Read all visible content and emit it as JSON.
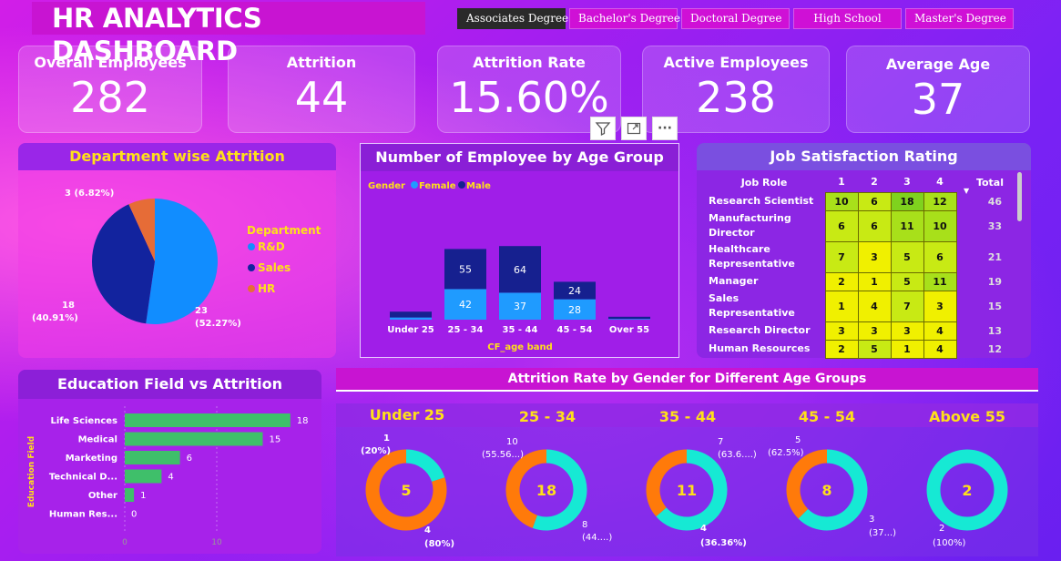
{
  "title": "HR ANALYTICS DASHBOARD",
  "slicers": [
    "Associates Degree",
    "Bachelor's Degree",
    "Doctoral Degree",
    "High School",
    "Master's Degree"
  ],
  "kpis": [
    {
      "label": "Overall Employees",
      "value": "282"
    },
    {
      "label": "Attrition",
      "value": "44"
    },
    {
      "label": "Attrition Rate",
      "value": "15.60%"
    },
    {
      "label": "Active Employees",
      "value": "238"
    },
    {
      "label": "Average Age",
      "value": "37"
    }
  ],
  "toolbar": {
    "filter_icon": "filter-icon",
    "focus_icon": "focus-mode-icon",
    "more": "···"
  },
  "dept": {
    "title": "Department wise Attrition",
    "legend_title": "Department",
    "legend": [
      "R&D",
      "Sales",
      "HR"
    ],
    "labels": {
      "hr": "3 (6.82%)",
      "sales_1": "18",
      "sales_2": "(40.91%)",
      "rd_1": "23",
      "rd_2": "(52.27%)"
    }
  },
  "age": {
    "title": "Number of Employee by Age Group",
    "legend_title": "Gender",
    "legend": [
      "Female",
      "Male"
    ],
    "xlabel": "CF_age band"
  },
  "job": {
    "title": "Job Satisfaction Rating",
    "headers": [
      "Job Role",
      "1",
      "2",
      "3",
      "4",
      "Total"
    ],
    "rows": [
      {
        "role": "Research Scientist",
        "v": [
          "10",
          "6",
          "18",
          "12"
        ],
        "total": "46"
      },
      {
        "role": "Manufacturing Director",
        "v": [
          "6",
          "6",
          "11",
          "10"
        ],
        "total": "33"
      },
      {
        "role": "Healthcare Representative",
        "v": [
          "7",
          "3",
          "5",
          "6"
        ],
        "total": "21"
      },
      {
        "role": "Manager",
        "v": [
          "2",
          "1",
          "5",
          "11"
        ],
        "total": "19"
      },
      {
        "role": "Sales Representative",
        "v": [
          "1",
          "4",
          "7",
          "3"
        ],
        "total": "15"
      },
      {
        "role": "Research Director",
        "v": [
          "3",
          "3",
          "3",
          "4"
        ],
        "total": "13"
      },
      {
        "role": "Human Resources",
        "v": [
          "2",
          "5",
          "1",
          "4"
        ],
        "total": "12"
      }
    ]
  },
  "edu": {
    "title": "Education Field vs Attrition",
    "ylabel": "Education Field"
  },
  "gender": {
    "title": "Attrition Rate by Gender for Different Age Groups"
  },
  "donuts": [
    {
      "title": "Under 25",
      "center": "5",
      "l1": "1",
      "l2": "(20%)",
      "l3": "4",
      "l4": "(80%)"
    },
    {
      "title": "25 - 34",
      "center": "18",
      "l1": "10",
      "l2": "(55.56...)",
      "l3": "8",
      "l4": "(44....)"
    },
    {
      "title": "35 - 44",
      "center": "11",
      "l1": "7",
      "l2": "(63.6....)",
      "l3": "4",
      "l4": "(36.36%)"
    },
    {
      "title": "45 - 54",
      "center": "8",
      "l1": "5",
      "l2": "(62.5%)",
      "l3": "3",
      "l4": "(37...)"
    },
    {
      "title": "Above 55",
      "center": "2",
      "l1": "2",
      "l2": "(100%)"
    }
  ],
  "colors": {
    "rd": "#118dff",
    "sales": "#12239e",
    "hr": "#e66c37",
    "female": "#1f9bff",
    "male": "#16208f",
    "bar": "#3fbf6a",
    "teal": "#16e9d4",
    "orange": "#ff7a0a",
    "yellow": "#ffe01a"
  },
  "chart_data": [
    {
      "type": "pie",
      "title": "Department wise Attrition",
      "categories": [
        "R&D",
        "Sales",
        "HR"
      ],
      "values": [
        23,
        18,
        3
      ],
      "percent": [
        52.27,
        40.91,
        6.82
      ]
    },
    {
      "type": "bar",
      "title": "Number of Employee by Age Group",
      "xlabel": "CF_age band",
      "categories": [
        "Under 25",
        "25 - 34",
        "35 - 44",
        "45 - 54",
        "Over 55"
      ],
      "series": [
        {
          "name": "Female",
          "values": [
            3,
            42,
            37,
            28,
            1
          ]
        },
        {
          "name": "Male",
          "values": [
            8,
            55,
            64,
            24,
            3
          ]
        }
      ],
      "stacked": true
    },
    {
      "type": "bar",
      "title": "Education Field vs Attrition",
      "ylabel": "Education Field",
      "orientation": "horizontal",
      "categories": [
        "Life Sciences",
        "Medical",
        "Marketing",
        "Technical D...",
        "Other",
        "Human Res..."
      ],
      "values": [
        18,
        15,
        6,
        4,
        1,
        0
      ],
      "xticks": [
        "0",
        "10"
      ]
    },
    {
      "type": "pie",
      "title": "Attrition Rate by Gender for Different Age Groups",
      "donut": true,
      "groups": [
        {
          "name": "Under 25",
          "total": 5,
          "values": [
            1,
            4
          ]
        },
        {
          "name": "25 - 34",
          "total": 18,
          "values": [
            10,
            8
          ]
        },
        {
          "name": "35 - 44",
          "total": 11,
          "values": [
            7,
            4
          ]
        },
        {
          "name": "45 - 54",
          "total": 8,
          "values": [
            5,
            3
          ]
        },
        {
          "name": "Above 55",
          "total": 2,
          "values": [
            2,
            0
          ]
        }
      ]
    }
  ]
}
